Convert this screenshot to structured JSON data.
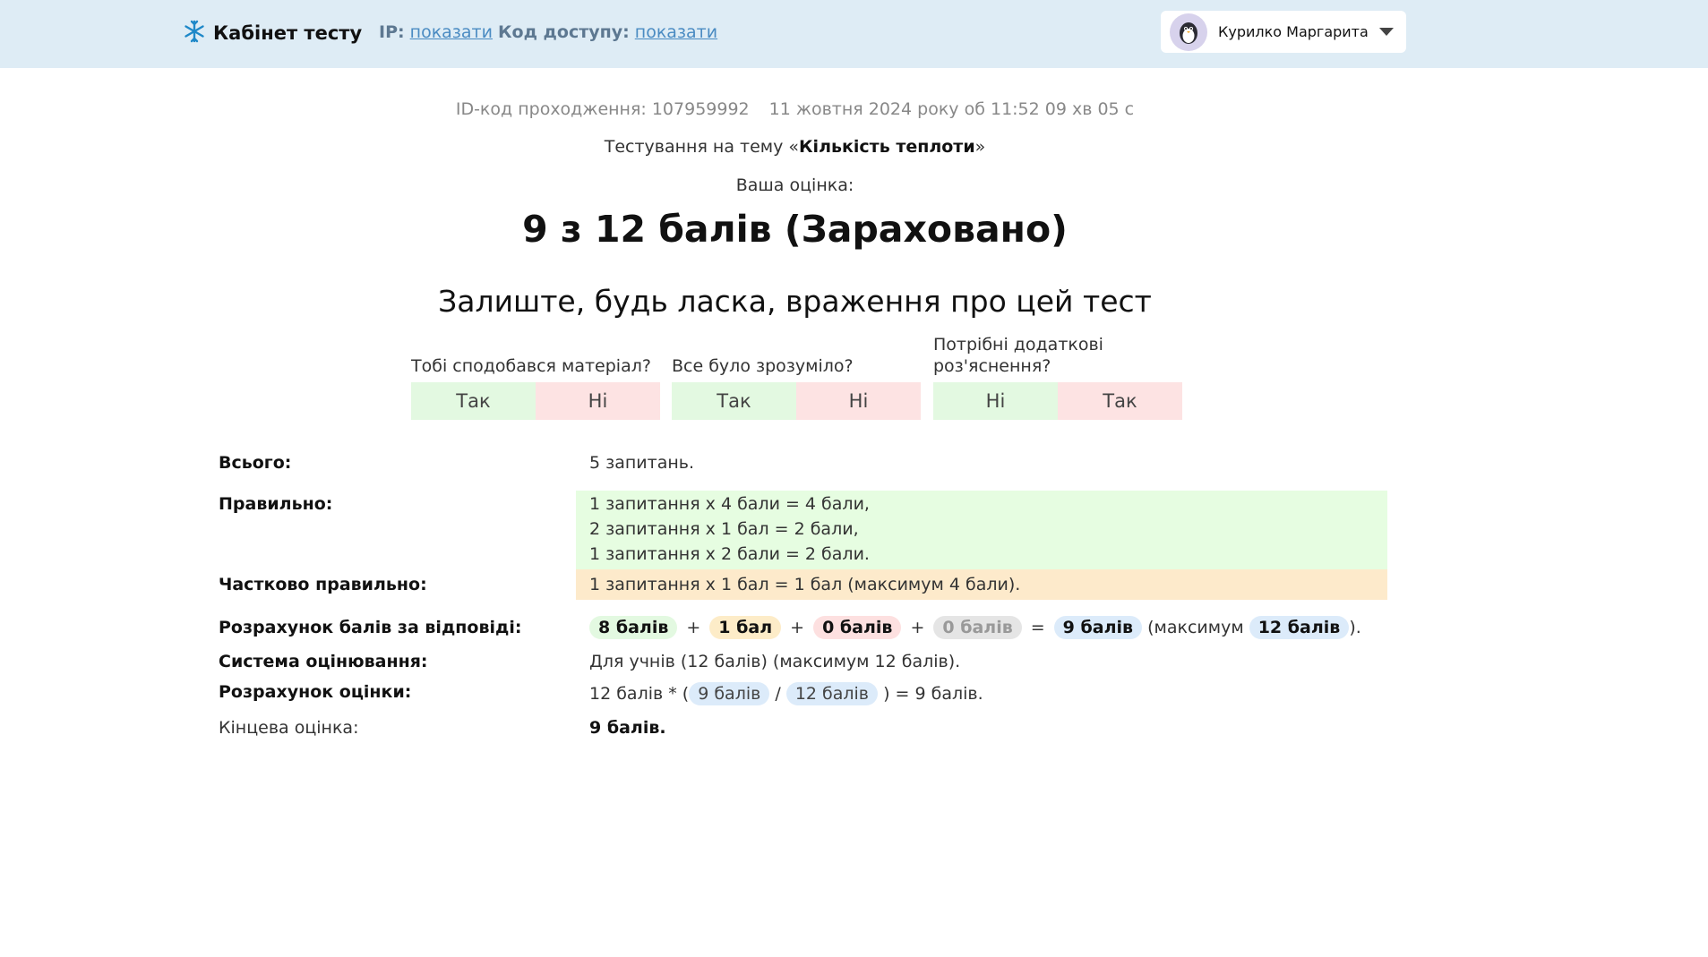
{
  "header": {
    "title": "Кабінет тесту",
    "ip_label": "IP:",
    "ip_link": "показати",
    "code_label": "Код доступу:",
    "code_link": "показати",
    "user_name": "Курилко Маргарита",
    "logo_icon": "snowflake-icon",
    "dropdown_icon": "caret-down-icon"
  },
  "meta": {
    "id_text": "ID-код проходження: 107959992",
    "date_text": "11 жовтня 2024 року об 11:52 09 хв 05 с"
  },
  "topic": {
    "prefix": "Тестування на тему «",
    "name": "Кількість теплоти",
    "suffix": "»"
  },
  "grade": {
    "label": "Ваша оцінка:",
    "value": "9 з 12 балів (Зараховано)"
  },
  "feedback": {
    "title": "Залиште, будь ласка, враження про цей тест",
    "questions": [
      {
        "text": "Тобі сподобався матеріал?",
        "left": "Так",
        "right": "Ні"
      },
      {
        "text": "Все було зрозуміло?",
        "left": "Так",
        "right": "Ні"
      },
      {
        "text": "Потрібні додаткові роз'яснення?",
        "left": "Ні",
        "right": "Так"
      }
    ]
  },
  "summary": {
    "total_label": "Всього:",
    "total_value": "5 запитань.",
    "correct_label": "Правильно:",
    "correct_lines": [
      "1 запитання x 4 бали = 4 бали,",
      "2 запитання x 1 бал = 2 бали,",
      "1 запитання x 2 бали = 2 бали."
    ],
    "partial_label": "Частково правильно:",
    "partial_value": "1 запитання x 1 бал = 1 бал (максимум 4 бали).",
    "calc_label": "Розрахунок балів за відповіді:",
    "calc": {
      "p1": "8 балів",
      "plus1": "+",
      "p2": "1 бал",
      "plus2": "+",
      "p3": "0 балів",
      "plus3": "+",
      "p4": "0 балів",
      "eq": "=",
      "sum": "9 балів",
      "max_prefix": "(максимум",
      "max": "12 балів",
      "max_suffix": ")."
    },
    "system_label": "Система оцінювання:",
    "system_value": "Для учнів (12 балів) (максимум 12 балів).",
    "grade_calc_label": "Розрахунок оцінки:",
    "grade_calc": {
      "prefix": "12 балів * (",
      "a": "9 балів",
      "slash": "/",
      "b": "12 балів",
      "suffix": ") = 9 балів."
    },
    "final_label": "Кінцева оцінка:",
    "final_value": "9 балів."
  }
}
